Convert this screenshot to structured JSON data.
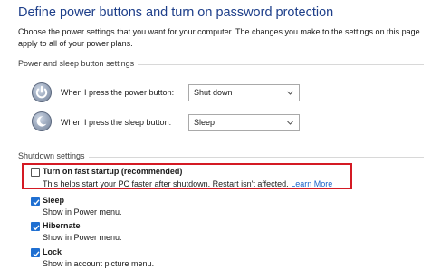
{
  "page": {
    "title": "Define power buttons and turn on password protection",
    "intro": "Choose the power settings that you want for your computer. The changes you make to the settings on this page apply to all of your power plans."
  },
  "power_sleep": {
    "section_label": "Power and sleep button settings",
    "power_button": {
      "label": "When I press the power button:",
      "value": "Shut down",
      "icon": "power-icon"
    },
    "sleep_button": {
      "label": "When I press the sleep button:",
      "value": "Sleep",
      "icon": "sleep-icon"
    }
  },
  "shutdown": {
    "section_label": "Shutdown settings",
    "fast_startup": {
      "label": "Turn on fast startup (recommended)",
      "description": "This helps start your PC faster after shutdown. Restart isn't affected.",
      "link": "Learn More",
      "checked": false
    },
    "options": [
      {
        "label": "Sleep",
        "description": "Show in Power menu.",
        "checked": true
      },
      {
        "label": "Hibernate",
        "description": "Show in Power menu.",
        "checked": true
      },
      {
        "label": "Lock",
        "description": "Show in account picture menu.",
        "checked": true
      }
    ]
  },
  "colors": {
    "title": "#1e3f8a",
    "highlight_border": "#d41a24",
    "checkbox_checked": "#1f6fd1",
    "link": "#1a62c9"
  }
}
